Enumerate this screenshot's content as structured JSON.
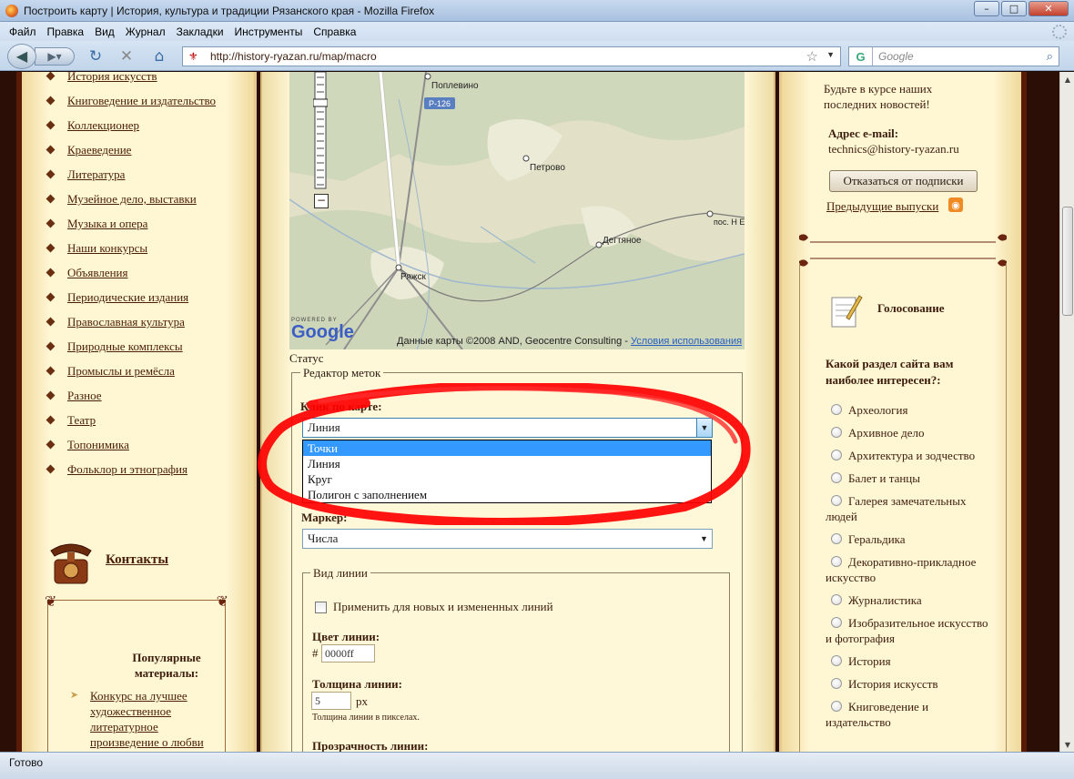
{
  "window": {
    "title": "Построить карту | История, культура и традиции Рязанского края - Mozilla Firefox"
  },
  "menu": [
    "Файл",
    "Правка",
    "Вид",
    "Журнал",
    "Закладки",
    "Инструменты",
    "Справка"
  ],
  "address": {
    "url": "http://history-ryazan.ru/map/macro"
  },
  "search": {
    "placeholder": "Google"
  },
  "status_bar": {
    "text": "Готово"
  },
  "left": {
    "categories": [
      "История искусств",
      "Книговедение и издательство",
      "Коллекционер",
      "Краеведение",
      "Литература",
      "Музейное дело, выставки",
      "Музыка и опера",
      "Наши конкурсы",
      "Объявления",
      "Периодические издания",
      "Православная культура",
      "Природные комплексы",
      "Промыслы и ремёсла",
      "Разное",
      "Театр",
      "Топонимика",
      "Фольклор и этнография"
    ],
    "contacts": "Контакты",
    "popular_title": "Популярные материалы:",
    "popular_item": "Конкурс на лучшее художественное литературное произведение о любви"
  },
  "map": {
    "labels": {
      "r126": "Р-126",
      "poplevino": "Поплевино",
      "petrovo": "Петрово",
      "degtyanoe": "Дегтяное",
      "egoldaevo": "пос. Н Еголдае",
      "ryazhsk": "Ряжск"
    },
    "powered": "POWERED BY",
    "google": "Google",
    "attribution": "Данные карты ©2008 AND, Geocentre Consulting -",
    "terms": "Условия использования"
  },
  "editor": {
    "status_label": "Статус",
    "legend": "Редактор меток",
    "click_label": "Клик по карте:",
    "click_value": "Линия",
    "click_options": [
      "Точки",
      "Линия",
      "Круг",
      "Полигон с заполнением"
    ],
    "click_highlighted_index": 0,
    "marker_label": "Маркер:",
    "marker_value": "Числа",
    "line_legend": "Вид линии",
    "apply_label": "Применить для новых и измененных линий",
    "color_label": "Цвет линии:",
    "color_prefix": "#",
    "color_value": "0000ff",
    "width_label": "Толщина линии:",
    "width_value": "5",
    "width_unit": "px",
    "width_hint": "Толщина линии в пикселах.",
    "opacity_label": "Прозрачность линии:"
  },
  "right": {
    "subscribe_text": "Будьте в курсе наших последних новостей!",
    "email_label": "Адрес e-mail:",
    "email_value": "technics@history-ryazan.ru",
    "unsubscribe_button": "Отказаться от подписки",
    "previous_issues": "Предыдущие выпуски",
    "vote_title": "Голосование",
    "question": "Какой раздел сайта вам наиболее интересен?:",
    "options": [
      "Археология",
      "Архивное дело",
      "Архитектура и зодчество",
      "Балет и танцы",
      "Галерея замечательных людей",
      "Геральдика",
      "Декоративно-прикладное искусство",
      "Журналистика",
      "Изобразительное искусство и фотография",
      "История",
      "История искусств",
      "Книговедение и издательство"
    ]
  },
  "colors": {
    "highlight": "#3399ff",
    "annotation": "#ff0000",
    "page_bg": "#fff8d8",
    "frame": "#5a1a08"
  }
}
